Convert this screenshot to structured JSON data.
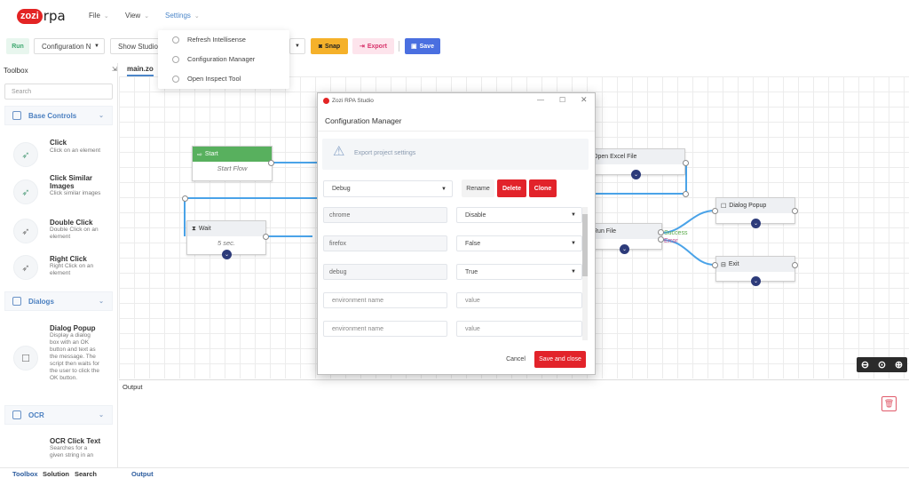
{
  "app": {
    "logo_badge": "zozi",
    "logo_text": "rpa"
  },
  "menu": [
    {
      "label": "File"
    },
    {
      "label": "View"
    },
    {
      "label": "Settings"
    }
  ],
  "settings_menu": [
    {
      "label": "Refresh Intellisense"
    },
    {
      "label": "Configuration Manager"
    },
    {
      "label": "Open Inspect Tool"
    }
  ],
  "toolbar": {
    "run": "Run",
    "config_select": "Configuration N",
    "studio_select": "Show Studio",
    "snap": "Snap",
    "export": "Export",
    "save": "Save"
  },
  "toolbox": {
    "title": "Toolbox",
    "search_placeholder": "Search",
    "categories": [
      {
        "label": "Base Controls"
      },
      {
        "label": "Dialogs"
      },
      {
        "label": "OCR"
      }
    ],
    "tools": [
      {
        "name": "Click",
        "desc": "Click on an element"
      },
      {
        "name": "Click Similar Images",
        "desc": "Click similar images"
      },
      {
        "name": "Double Click",
        "desc": "Double Click on an element"
      },
      {
        "name": "Right Click",
        "desc": "Right Click on an element"
      },
      {
        "name": "Dialog Popup",
        "desc": "Display a dialog box with an OK button and text as the message. The script then waits for the user to click the OK button."
      },
      {
        "name": "OCR Click Text",
        "desc": "Searches for a given string in an"
      }
    ]
  },
  "bottom_tabs": [
    "Toolbox",
    "Solution",
    "Search",
    "Output"
  ],
  "canvas": {
    "tab": "main.zo",
    "nodes": {
      "start": {
        "title": "Start",
        "body": "Start Flow"
      },
      "wait": {
        "title": "Wait",
        "body": "5 sec."
      },
      "open_excel": {
        "title": "Open Excel File"
      },
      "run_file": {
        "title": "Run File"
      },
      "dialog_popup": {
        "title": "Dialog Popup"
      },
      "exit": {
        "title": "Exit"
      }
    },
    "labels": {
      "success": "Success",
      "error": "Error"
    }
  },
  "output": {
    "title": "Output"
  },
  "dialog": {
    "titlebar": "Zozi RPA Studio",
    "heading": "Configuration Manager",
    "info": "Export project settings",
    "config_select": "Debug",
    "rename": "Rename",
    "delete": "Delete",
    "clone": "Clone",
    "rows": [
      {
        "key": "chrome",
        "value": "Disable",
        "dropdown": true
      },
      {
        "key": "firefox",
        "value": "False",
        "dropdown": true
      },
      {
        "key": "debug",
        "value": "True",
        "dropdown": true
      },
      {
        "key": "environment name",
        "value": "value",
        "dropdown": false
      },
      {
        "key": "environment name",
        "value": "value",
        "dropdown": false
      }
    ],
    "cancel": "Cancel",
    "save_close": "Save and close"
  },
  "colors": {
    "accent": "#4b86c9",
    "danger": "#e2232a",
    "run": "#3da86f",
    "start_node": "#58b05e",
    "snap": "#f5b12a",
    "save": "#4a6fe0"
  },
  "icons": [
    "cursor-icon",
    "dialog-icon",
    "trash-icon",
    "zoom-out-icon",
    "zoom-reset-icon",
    "zoom-in-icon",
    "warning-icon"
  ]
}
